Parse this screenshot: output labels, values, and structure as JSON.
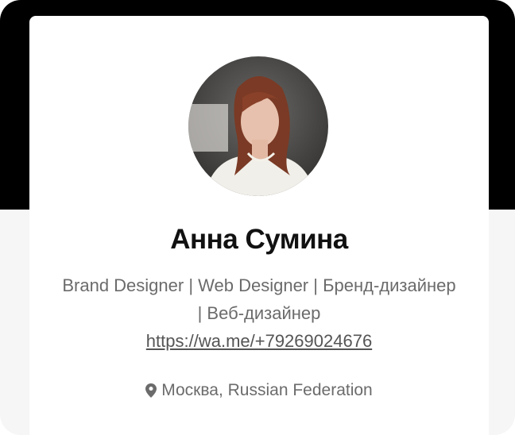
{
  "profile": {
    "name": "Анна Сумина",
    "bio": "Brand Designer | Web Designer | Бренд-дизайнер | Веб-дизайнер",
    "link": "https://wa.me/+79269024676",
    "location": "Москва, Russian Federation",
    "avatar_icon": "profile-photo"
  },
  "colors": {
    "banner": "#000000",
    "card": "#ffffff",
    "text_primary": "#111111",
    "text_secondary": "#6b6b6b"
  }
}
